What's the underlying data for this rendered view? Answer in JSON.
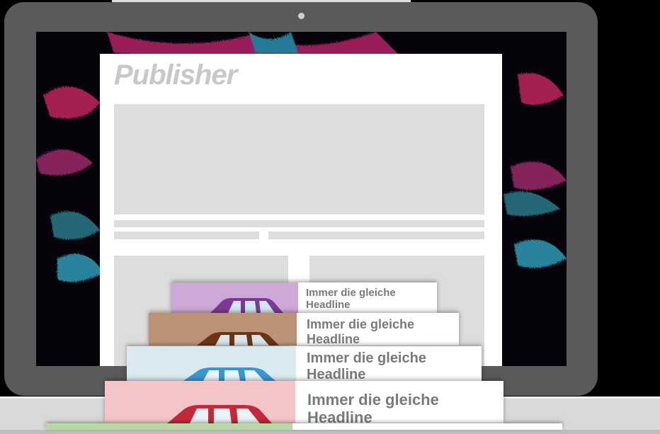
{
  "publisher": {
    "title": "Publisher"
  },
  "ad_cards": [
    {
      "headline": "Immer die gleiche Headline",
      "color": "#cda9d5",
      "car_color": "#7b3a9a"
    },
    {
      "headline": "Immer die gleiche Headline",
      "color": "#bc9377",
      "car_color": "#6a3416"
    },
    {
      "headline": "Immer die gleiche Headline",
      "color": "#d9eaf1",
      "car_color": "#3a97cf"
    },
    {
      "headline": "Immer die gleiche Headline",
      "color": "#f3c5c6",
      "car_color": "#c5283a"
    },
    {
      "headline": "",
      "color": "#b8d9a6",
      "car_color": ""
    }
  ],
  "colors": {
    "laptop_frame": "#5a5a5a",
    "laptop_base": "#d9d9d9",
    "placeholder_grey": "#dedddb",
    "title_grey": "#c8c8c8"
  }
}
